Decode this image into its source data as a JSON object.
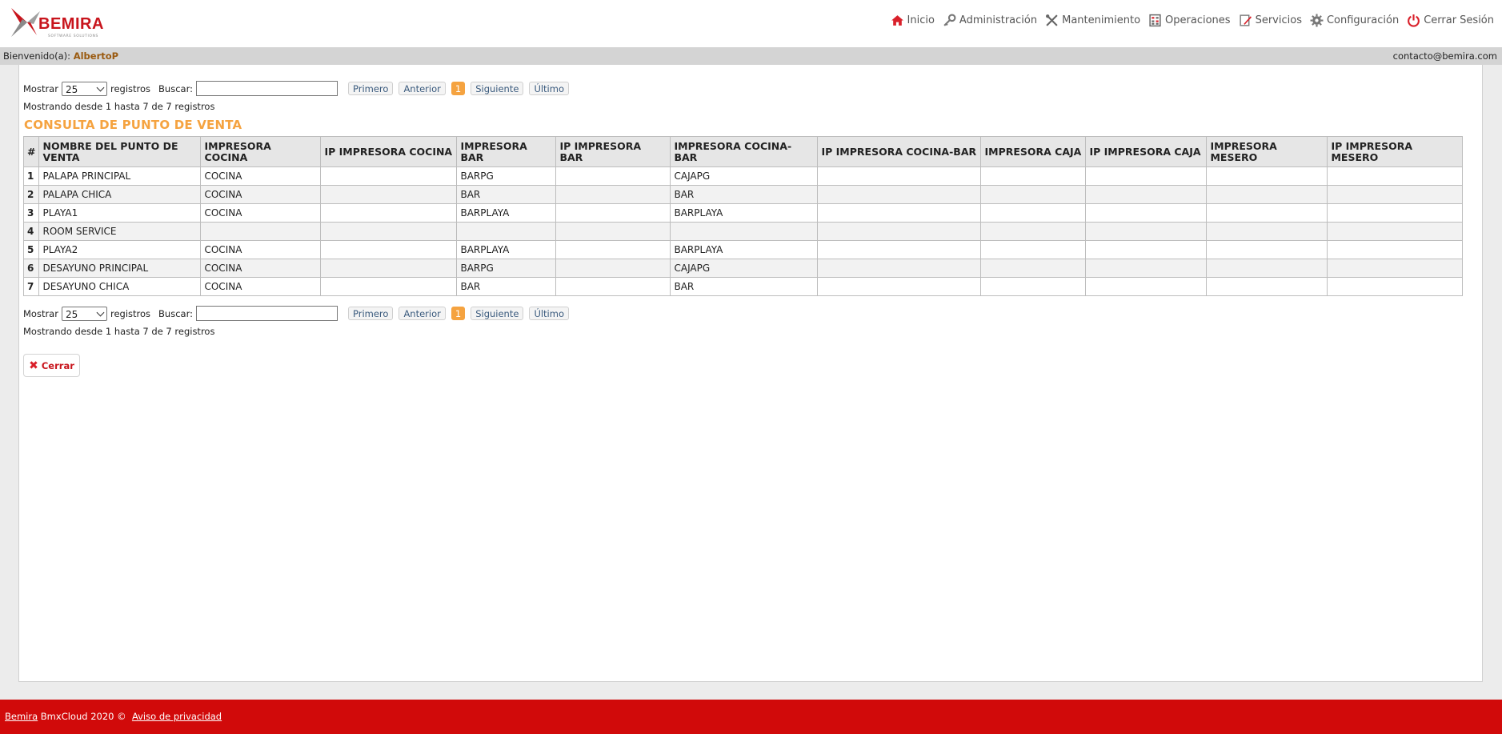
{
  "brand": {
    "name": "BEMIRA",
    "tagline": "SOFTWARE SOLUTIONS",
    "color": "#c8141c"
  },
  "nav": [
    {
      "label": "Inicio",
      "icon": "home-icon"
    },
    {
      "label": "Administración",
      "icon": "key-icon"
    },
    {
      "label": "Mantenimiento",
      "icon": "tools-icon"
    },
    {
      "label": "Operaciones",
      "icon": "calculator-icon"
    },
    {
      "label": "Servicios",
      "icon": "edit-icon"
    },
    {
      "label": "Configuración",
      "icon": "gear-icon"
    },
    {
      "label": "Cerrar Sesión",
      "icon": "power-icon"
    }
  ],
  "welcome": {
    "label": "Bienvenido(a):",
    "user": "AlbertoP",
    "email": "contacto@bemira.com"
  },
  "controls": {
    "show_label": "Mostrar",
    "page_size": "25",
    "records_label": "registros",
    "search_label": "Buscar:",
    "search_value": "",
    "pager": {
      "first": "Primero",
      "prev": "Anterior",
      "current": "1",
      "next": "Siguiente",
      "last": "Último"
    },
    "info": "Mostrando desde 1 hasta 7 de 7 registros"
  },
  "title": "CONSULTA DE PUNTO DE VENTA",
  "table": {
    "headers": [
      "#",
      "NOMBRE DEL PUNTO DE VENTA",
      "IMPRESORA COCINA",
      "IP IMPRESORA COCINA",
      "IMPRESORA BAR",
      "IP IMPRESORA BAR",
      "IMPRESORA COCINA-BAR",
      "IP IMPRESORA COCINA-BAR",
      "IMPRESORA CAJA",
      "IP IMPRESORA CAJA",
      "IMPRESORA MESERO",
      "IP IMPRESORA MESERO"
    ],
    "rows": [
      [
        "1",
        "PALAPA PRINCIPAL",
        "COCINA",
        "",
        "BARPG",
        "",
        "CAJAPG",
        "",
        "",
        "",
        "",
        ""
      ],
      [
        "2",
        "PALAPA CHICA",
        "COCINA",
        "",
        "BAR",
        "",
        "BAR",
        "",
        "",
        "",
        "",
        ""
      ],
      [
        "3",
        "PLAYA1",
        "COCINA",
        "",
        "BARPLAYA",
        "",
        "BARPLAYA",
        "",
        "",
        "",
        "",
        ""
      ],
      [
        "4",
        "ROOM SERVICE",
        "",
        "",
        "",
        "",
        "",
        "",
        "",
        "",
        "",
        ""
      ],
      [
        "5",
        "PLAYA2",
        "COCINA",
        "",
        "BARPLAYA",
        "",
        "BARPLAYA",
        "",
        "",
        "",
        "",
        ""
      ],
      [
        "6",
        "DESAYUNO PRINCIPAL",
        "COCINA",
        "",
        "BARPG",
        "",
        "CAJAPG",
        "",
        "",
        "",
        "",
        ""
      ],
      [
        "7",
        "DESAYUNO CHICA",
        "COCINA",
        "",
        "BAR",
        "",
        "BAR",
        "",
        "",
        "",
        "",
        ""
      ]
    ]
  },
  "close_button": {
    "label": "Cerrar",
    "icon": "close-icon"
  },
  "footer": {
    "brand_link": "Bemira",
    "text": "BmxCloud 2020 ©",
    "privacy_link": "Aviso de privacidad",
    "color": "#d10a0a"
  }
}
